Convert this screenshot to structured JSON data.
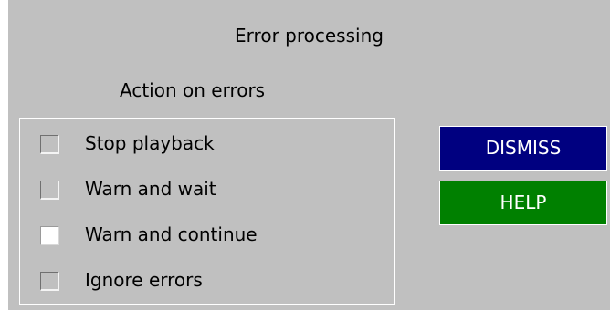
{
  "dialog": {
    "title": "Error processing",
    "section_label": "Action on errors"
  },
  "options": [
    {
      "label": "Stop playback",
      "checked": false
    },
    {
      "label": "Warn and wait",
      "checked": false
    },
    {
      "label": "Warn and continue",
      "checked": true
    },
    {
      "label": "Ignore errors",
      "checked": false
    }
  ],
  "buttons": {
    "dismiss_label": "DISMISS",
    "help_label": "HELP"
  },
  "colors": {
    "panel_bg": "#c0c0c0",
    "dismiss_bg": "#000080",
    "help_bg": "#008000",
    "button_text": "#ffffff"
  }
}
